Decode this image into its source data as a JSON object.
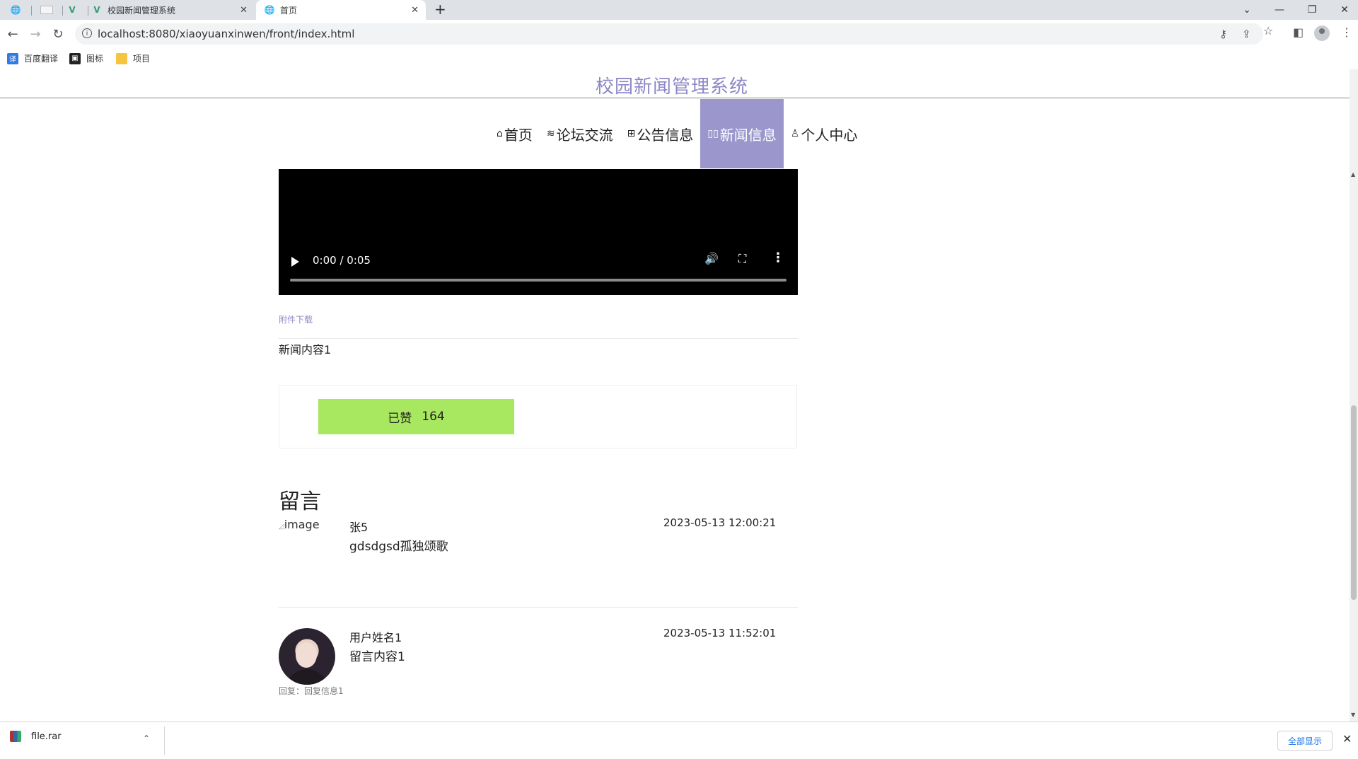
{
  "browser": {
    "tabs": [
      {
        "title": "",
        "icon": "globe-icon"
      },
      {
        "title": "",
        "icon": "blank-page-icon"
      },
      {
        "title": "",
        "icon": "vue-icon"
      },
      {
        "title": "校园新闻管理系统",
        "icon": "vue-icon"
      },
      {
        "title": "首页",
        "icon": "globe-icon"
      }
    ],
    "url": "localhost:8080/xiaoyuanxinwen/front/index.html",
    "bookmarks": [
      {
        "label": "百度翻译",
        "icon": "translate-icon",
        "color": "#2f7ae5"
      },
      {
        "label": "图标",
        "icon": "image-icon",
        "color": "#222222"
      },
      {
        "label": "项目",
        "icon": "folder-icon",
        "color": "#f5c542"
      }
    ]
  },
  "site": {
    "title": "校园新闻管理系统",
    "brand_color": "#8c87c7",
    "menu": [
      {
        "label": "首页",
        "icon": "home-icon"
      },
      {
        "label": "论坛交流",
        "icon": "layers-icon"
      },
      {
        "label": "公告信息",
        "icon": "gift-icon"
      },
      {
        "label": "新闻信息",
        "icon": "news-icon",
        "active": true
      },
      {
        "label": "个人中心",
        "icon": "user-icon"
      }
    ]
  },
  "video": {
    "time": "0:00 / 0:05",
    "progress": 0
  },
  "article": {
    "attachment_link": "附件下载",
    "content": "新闻内容1",
    "like_label": "已赞",
    "like_count": "164",
    "like_color": "#a8e860"
  },
  "comments_section": {
    "heading": "留言",
    "comments": [
      {
        "avatar_alt": "image",
        "name": "张5",
        "text": "gdsdgsd孤独颂歌",
        "time": "2023-05-13 12:00:21"
      },
      {
        "avatar_alt": "",
        "name": "用户姓名1",
        "text": "留言内容1",
        "time": "2023-05-13 11:52:01",
        "reply": "回复：回复信息1"
      }
    ]
  },
  "downloads": {
    "file": "file.rar",
    "show_all": "全部显示"
  }
}
